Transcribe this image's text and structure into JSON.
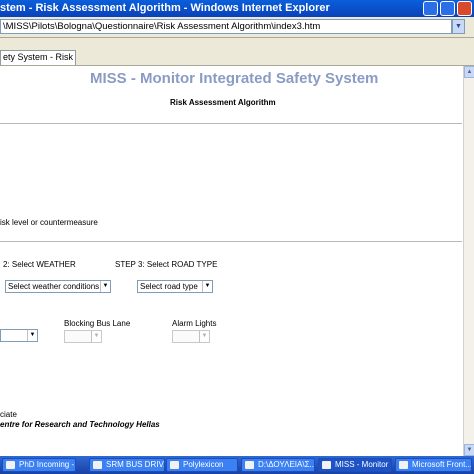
{
  "window": {
    "title": "stem - Risk Assessment Algorithm - Windows Internet Explorer"
  },
  "address": {
    "url": "\\MISS\\Pilots\\Bologna\\Questionnaire\\Risk Assessment Algorithm\\index3.htm"
  },
  "tab": {
    "label": "ety System - Risk Asses..."
  },
  "page": {
    "title": "MISS - Monitor Integrated Safety System",
    "subtitle": "Risk Assessment Algorithm",
    "risk_text": "isk level or countermeasure",
    "step2_label": "2: Select WEATHER",
    "step3_label": "STEP 3: Select ROAD TYPE",
    "weather_select": "Select weather conditions",
    "road_select": "Select road type",
    "blocking_label": "Blocking Bus Lane",
    "alarm_label": "Alarm Lights",
    "footer_line1": "ciate",
    "footer_line2": "entre for Research and Technology Hellas"
  },
  "taskbar": {
    "items": [
      {
        "label": "PhD Incoming -..."
      },
      {
        "label": "SRM BUS DRIV..."
      },
      {
        "label": "Polylexicon"
      },
      {
        "label": "D:\\ΔΟΥΛΕΙΑ\\Σ..."
      },
      {
        "label": "MISS - Monitor ..."
      },
      {
        "label": "Microsoft Front..."
      }
    ]
  }
}
